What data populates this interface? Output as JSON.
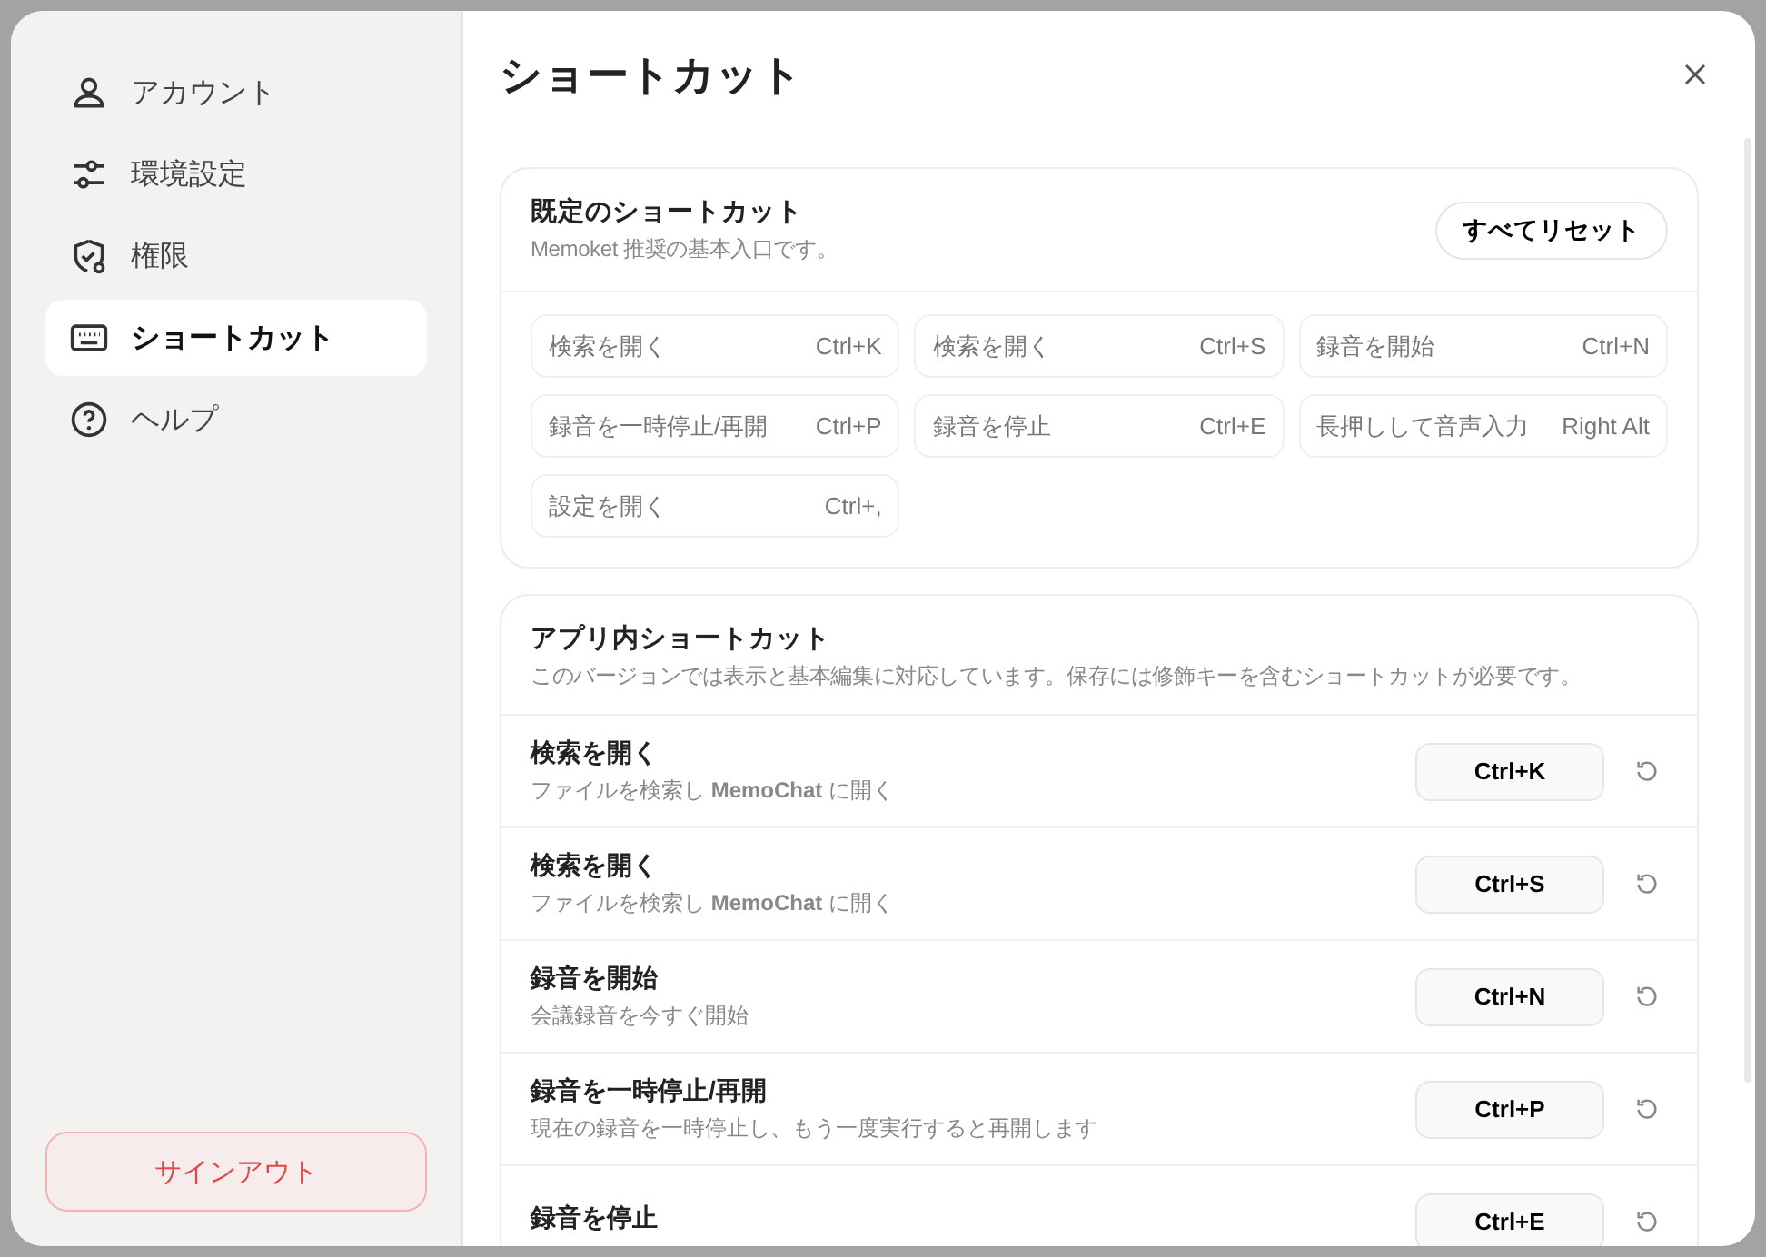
{
  "sidebar": {
    "items": [
      {
        "label": "アカウント",
        "selected": false
      },
      {
        "label": "環境設定",
        "selected": false
      },
      {
        "label": "権限",
        "selected": false
      },
      {
        "label": "ショートカット",
        "selected": true
      },
      {
        "label": "ヘルプ",
        "selected": false
      }
    ],
    "sign_out": "サインアウト"
  },
  "page": {
    "title": "ショートカット"
  },
  "defaults": {
    "title": "既定のショートカット",
    "subtitle": "Memoket 推奨の基本入口です。",
    "reset_all": "すべてリセット",
    "items": [
      {
        "action": "検索を開く",
        "keys": "Ctrl+K"
      },
      {
        "action": "検索を開く",
        "keys": "Ctrl+S"
      },
      {
        "action": "録音を開始",
        "keys": "Ctrl+N"
      },
      {
        "action": "録音を一時停止/再開",
        "keys": "Ctrl+P"
      },
      {
        "action": "録音を停止",
        "keys": "Ctrl+E"
      },
      {
        "action": "長押しして音声入力",
        "keys": "Right Alt"
      },
      {
        "action": "設定を開く",
        "keys": "Ctrl+,"
      }
    ]
  },
  "in_app": {
    "title": "アプリ内ショートカット",
    "subtitle": "このバージョンでは表示と基本編集に対応しています。保存には修飾キーを含むショートカットが必要です。",
    "rows": [
      {
        "title": "検索を開く",
        "description": "ファイルを検索し **MemoChat** に開く",
        "keys": "Ctrl+K"
      },
      {
        "title": "検索を開く",
        "description": "ファイルを検索し **MemoChat** に開く",
        "keys": "Ctrl+S"
      },
      {
        "title": "録音を開始",
        "description": "会議録音を今すぐ開始",
        "keys": "Ctrl+N"
      },
      {
        "title": "録音を一時停止/再開",
        "description": "現在の録音を一時停止し、もう一度実行すると再開します",
        "keys": "Ctrl+P"
      },
      {
        "title": "録音を停止",
        "keys": "Ctrl+E"
      }
    ]
  }
}
